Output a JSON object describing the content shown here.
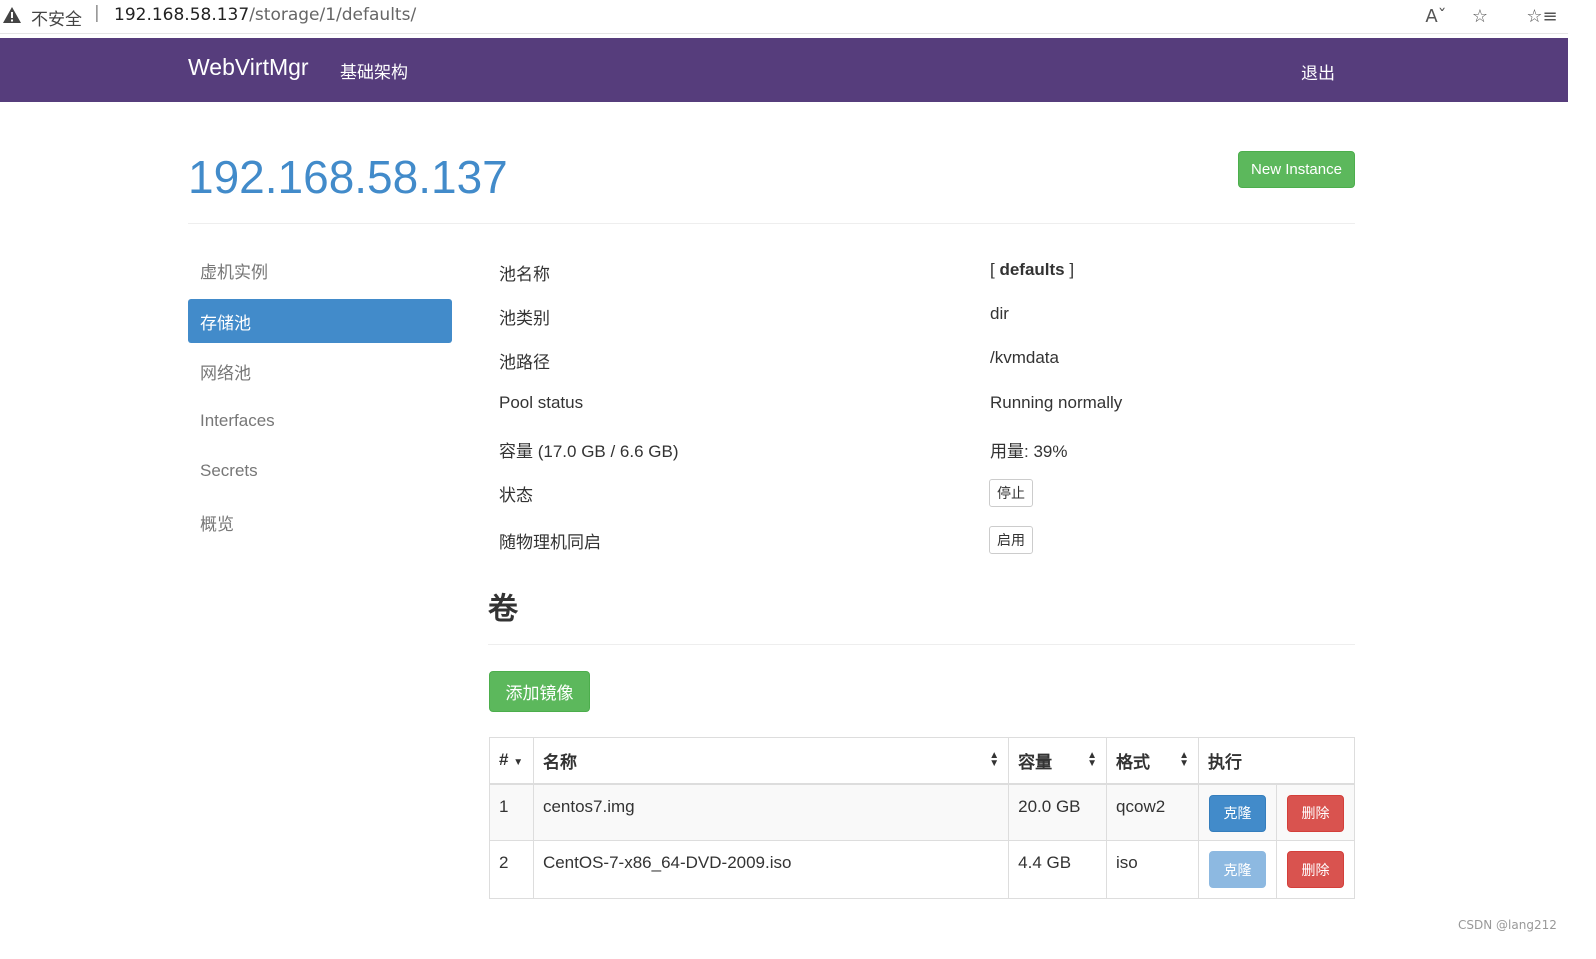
{
  "browser": {
    "insecure_label": "不安全",
    "separator": "|",
    "url_host": "192.168.58.137",
    "url_path": "/storage/1/defaults/"
  },
  "navbar": {
    "brand": "WebVirtMgr",
    "infra_link": "基础架构",
    "logout": "退出"
  },
  "header": {
    "host_title": "192.168.58.137",
    "new_instance_label": "New Instance"
  },
  "sidebar": {
    "items": [
      {
        "label": "虚机实例",
        "active": false
      },
      {
        "label": "存储池",
        "active": true
      },
      {
        "label": "网络池",
        "active": false
      },
      {
        "label": "Interfaces",
        "active": false
      },
      {
        "label": "Secrets",
        "active": false
      },
      {
        "label": "概览",
        "active": false
      }
    ]
  },
  "pool": {
    "name_label": "池名称",
    "name_value_prefix": "[ ",
    "name_value": "defaults",
    "name_value_suffix": " ]",
    "type_label": "池类别",
    "type_value": "dir",
    "path_label": "池路径",
    "path_value": "/kvmdata",
    "status_label": "Pool status",
    "status_value": "Running normally",
    "capacity_label": "容量 (17.0 GB / 6.6 GB)",
    "usage_value": "用量: 39%",
    "state_label": "状态",
    "stop_button": "停止",
    "autostart_label": "随物理机同启",
    "enable_button": "启用"
  },
  "volumes": {
    "title": "卷",
    "add_image_button": "添加镜像",
    "columns": {
      "num": "#",
      "name": "名称",
      "capacity": "容量",
      "format": "格式",
      "actions": "执行"
    },
    "rows": [
      {
        "num": "1",
        "name": "centos7.img",
        "capacity": "20.0 GB",
        "format": "qcow2",
        "clone": "克隆",
        "delete": "删除"
      },
      {
        "num": "2",
        "name": "CentOS-7-x86_64-DVD-2009.iso",
        "capacity": "4.4 GB",
        "format": "iso",
        "clone": "克隆",
        "delete": "删除"
      }
    ]
  },
  "watermark": "CSDN @lang212",
  "colors": {
    "navbar": "#563d7c",
    "primary": "#428bca",
    "success": "#5cb85c",
    "danger": "#d9534f"
  }
}
